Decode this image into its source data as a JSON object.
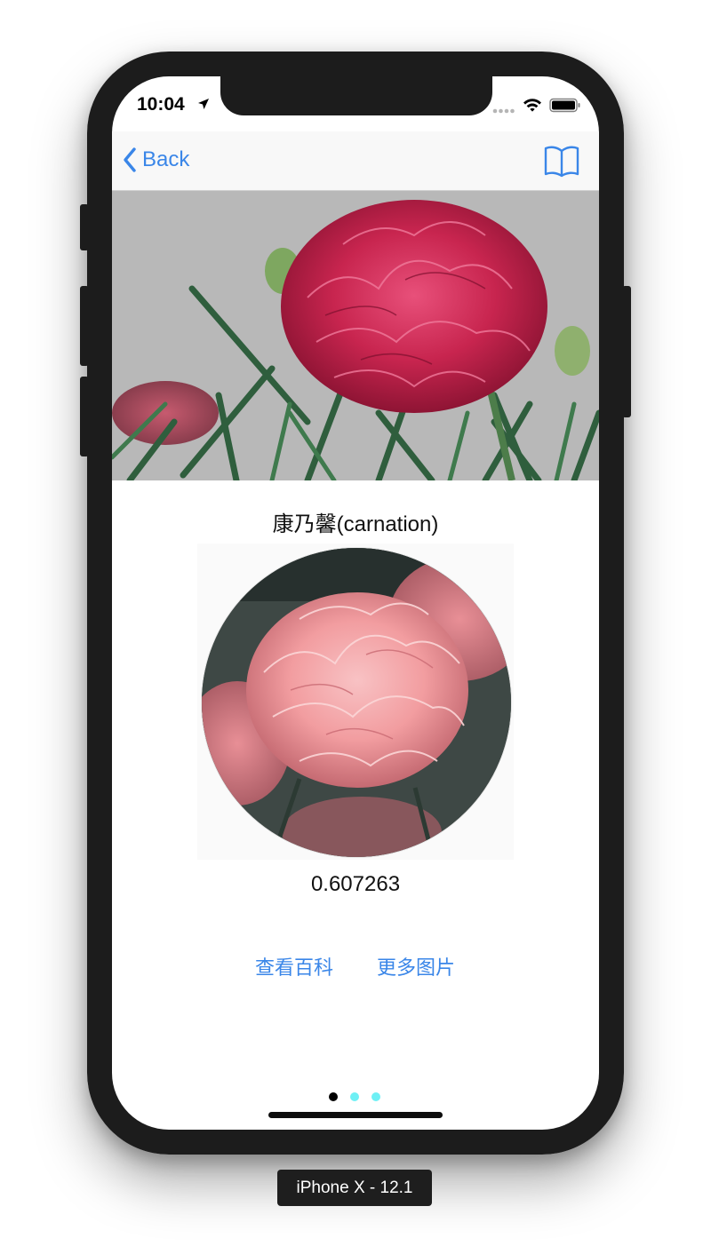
{
  "status_bar": {
    "time": "10:04",
    "icons": [
      "location-arrow-icon",
      "signal-dots-icon",
      "wifi-icon",
      "battery-icon"
    ]
  },
  "nav": {
    "back_label": "Back",
    "right_icon": "book-icon",
    "tint": "#3a86e8"
  },
  "result": {
    "title": "康乃馨(carnation)",
    "score": "0.607263"
  },
  "actions": {
    "encyclopedia": "查看百科",
    "more_images": "更多图片"
  },
  "pager": {
    "active_color": "#000000",
    "inactive_color": "#6ef0f5",
    "active_index": 0,
    "count": 3
  },
  "device": {
    "label": "iPhone X - 12.1"
  }
}
